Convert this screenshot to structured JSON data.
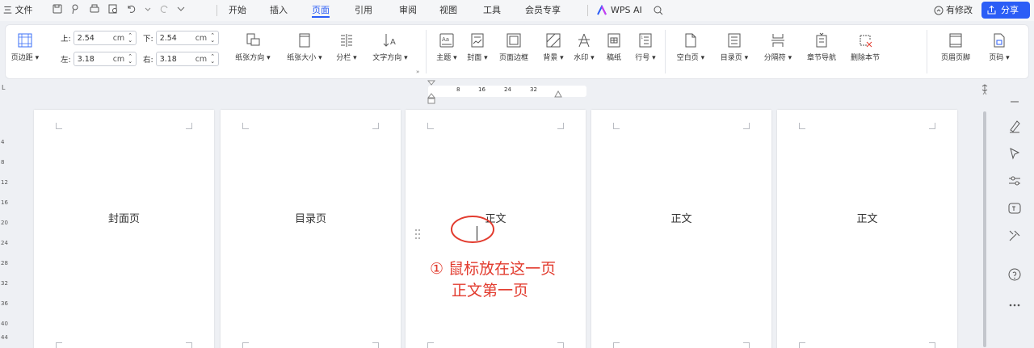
{
  "menubar": {
    "items": [
      "三 文件",
      "开始",
      "插入",
      "页面",
      "引用",
      "审阅",
      "视图",
      "工具",
      "会员专享",
      "WPS AI"
    ],
    "active_tab": "页面",
    "modified_label": "有修改",
    "share_label": "分享",
    "accent_color": "#2b5df6"
  },
  "ribbon": {
    "margins_label": "页边距",
    "top_label": "上:",
    "top_value": "2.54",
    "top_unit": "cm",
    "bottom_label": "下:",
    "bottom_value": "2.54",
    "bottom_unit": "cm",
    "left_label": "左:",
    "left_value": "3.18",
    "left_unit": "cm",
    "right_label": "右:",
    "right_value": "3.18",
    "right_unit": "cm",
    "orientation_label": "纸张方向",
    "size_label": "纸张大小",
    "columns_label": "分栏",
    "text_direction_label": "文字方向",
    "theme_label": "主题",
    "cover_label": "封面",
    "page_border_label": "页面边框",
    "background_label": "背景",
    "watermark_label": "水印",
    "manuscript_label": "稿纸",
    "line_number_label": "行号",
    "blank_page_label": "空白页",
    "toc_page_label": "目录页",
    "break_label": "分隔符",
    "section_nav_label": "章节导航",
    "delete_section_label": "删除本节",
    "header_footer_label": "页眉页脚",
    "page_number_label": "页码"
  },
  "ruler": {
    "ticks": [
      "8",
      "16",
      "24",
      "32"
    ]
  },
  "pages": [
    "封面页",
    "目录页",
    "正文",
    "正文",
    "正文"
  ],
  "left_ruler_marks": [
    "L",
    "4",
    "8",
    "12",
    "16",
    "20",
    "24",
    "28",
    "32",
    "36",
    "40",
    "44"
  ],
  "annotation": {
    "line1": "① 鼠标放在这一页",
    "line2": "正文第一页",
    "color": "#e23b2e"
  },
  "colors": {
    "accent": "#2b5df6",
    "annotation": "#e23b2e"
  }
}
